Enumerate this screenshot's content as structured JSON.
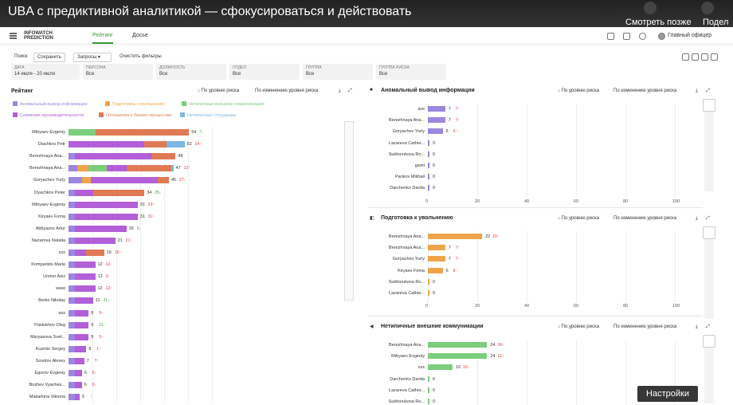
{
  "video": {
    "title": "UBA с предиктивной аналитикой — сфокусироваться и действовать",
    "watch_later": "Смотреть позже",
    "share": "Подел",
    "settings": "Настройки"
  },
  "app": {
    "logo_line1": "INFOWATCH",
    "logo_line2": "PREDICTION",
    "tabs": [
      "Рейтинг",
      "Досье"
    ],
    "user": "Главный офицер"
  },
  "toolbar": {
    "search": "Поиск",
    "save": "Сохранить",
    "queries": "Запросы",
    "clear": "Очистить фильтры"
  },
  "filters": [
    {
      "label": "ДАТА",
      "value": "14 июля - 20 июля"
    },
    {
      "label": "ПЕРСОНА",
      "value": "Все"
    },
    {
      "label": "ДОЛЖНОСТЬ",
      "value": "Все"
    },
    {
      "label": "ОТДЕЛ",
      "value": "Все"
    },
    {
      "label": "ГРУППА",
      "value": "Все"
    },
    {
      "label": "ГРУППА РИСКА",
      "value": "Все"
    }
  ],
  "rating": {
    "title": "Рейтинг",
    "sort1": "По уровню риска",
    "sort2": "По изменению уровня риска",
    "legend": [
      {
        "name": "Аномальный вывод информации",
        "color": "#9b87e0"
      },
      {
        "name": "Подготовка к увольнению",
        "color": "#f0a44a"
      },
      {
        "name": "Нетипичные внешние коммуникации",
        "color": "#7ccd7c"
      },
      {
        "name": "Снижение производительности",
        "color": "#b35fd8"
      },
      {
        "name": "Отношение к бизнес-процессам",
        "color": "#e07a55"
      },
      {
        "name": "Нетипичные сотрудники",
        "color": "#7fb6e3"
      }
    ],
    "rows": [
      {
        "name": "Mitryaev Evgeniy",
        "value": 54,
        "delta": "7",
        "dir": "down",
        "segs": [
          0,
          0,
          12,
          0,
          42,
          0
        ]
      },
      {
        "name": "Diachkov Petr",
        "value": 52,
        "delta": "14",
        "dir": "up",
        "segs": [
          0,
          0,
          0,
          34,
          10,
          8
        ]
      },
      {
        "name": "Berezhnaya Ana...",
        "value": 48,
        "delta": "",
        "dir": "",
        "segs": [
          3,
          0,
          0,
          34,
          11,
          0
        ]
      },
      {
        "name": "Berezhnaya Ana...",
        "value": 47,
        "delta": "12",
        "dir": "up",
        "segs": [
          4,
          5,
          8,
          9,
          20,
          1
        ]
      },
      {
        "name": "Goryachev Yuriy",
        "value": 45,
        "delta": "27",
        "dir": "up",
        "segs": [
          6,
          4,
          0,
          30,
          5,
          0
        ]
      },
      {
        "name": "Dyachkov Peter",
        "value": 34,
        "delta": "25",
        "dir": "down",
        "segs": [
          3,
          0,
          0,
          8,
          23,
          0
        ]
      },
      {
        "name": "Mitryaev Evgeniy",
        "value": 31,
        "delta": "23",
        "dir": "up",
        "segs": [
          3,
          0,
          0,
          28,
          0,
          0
        ]
      },
      {
        "name": "Kiryaev Foma",
        "value": 31,
        "delta": "31",
        "dir": "up",
        "segs": [
          3,
          0,
          0,
          28,
          0,
          0
        ]
      },
      {
        "name": "Abbyazov Artur",
        "value": 26,
        "delta": "5",
        "dir": "down",
        "segs": [
          3,
          0,
          0,
          23,
          0,
          0
        ]
      },
      {
        "name": "Nazarova Natalia",
        "value": 21,
        "delta": "21",
        "dir": "up",
        "segs": [
          3,
          0,
          0,
          18,
          0,
          0
        ]
      },
      {
        "name": "xxx",
        "value": 16,
        "delta": "16",
        "dir": "up",
        "segs": [
          3,
          0,
          0,
          5,
          8,
          0
        ]
      },
      {
        "name": "Komparists Maria",
        "value": 12,
        "delta": "12",
        "dir": "up",
        "segs": [
          3,
          0,
          0,
          9,
          0,
          0
        ]
      },
      {
        "name": "Unrinn Aziz",
        "value": 12,
        "delta": "3",
        "dir": "up",
        "segs": [
          3,
          0,
          0,
          9,
          0,
          0
        ]
      },
      {
        "name": "www",
        "value": 12,
        "delta": "12",
        "dir": "up",
        "segs": [
          3,
          0,
          0,
          9,
          0,
          0
        ]
      },
      {
        "name": "Berko Nikolay",
        "value": 11,
        "delta": "11",
        "dir": "down",
        "segs": [
          3,
          0,
          0,
          8,
          0,
          0
        ]
      },
      {
        "name": "avs",
        "value": 9,
        "delta": "9",
        "dir": "up",
        "segs": [
          3,
          0,
          0,
          6,
          0,
          0
        ]
      },
      {
        "name": "Pastukhov Oleg",
        "value": 9,
        "delta": "11",
        "dir": "down",
        "segs": [
          3,
          0,
          0,
          6,
          0,
          0
        ]
      },
      {
        "name": "Maryasova Svet...",
        "value": 9,
        "delta": "3",
        "dir": "up",
        "segs": [
          3,
          0,
          0,
          6,
          0,
          0
        ]
      },
      {
        "name": "Kuzmin Sergey",
        "value": 8,
        "delta": "1",
        "dir": "up",
        "segs": [
          3,
          0,
          0,
          5,
          0,
          0
        ]
      },
      {
        "name": "Sovidov Alexey",
        "value": 7,
        "delta": "7",
        "dir": "up",
        "segs": [
          3,
          0,
          0,
          4,
          0,
          0
        ]
      },
      {
        "name": "Egorov Evgeniy",
        "value": 6,
        "delta": "6",
        "dir": "up",
        "segs": [
          3,
          0,
          0,
          3,
          0,
          0
        ]
      },
      {
        "name": "Bozhev Vyaches...",
        "value": 6,
        "delta": "6",
        "dir": "up",
        "segs": [
          3,
          0,
          0,
          3,
          0,
          0
        ]
      },
      {
        "name": "Makarkina Viktoria",
        "value": 5,
        "delta": "",
        "dir": "up",
        "segs": [
          3,
          0,
          0,
          2,
          0,
          0
        ]
      }
    ]
  },
  "panels": [
    {
      "title": "Аномальный вывод информации",
      "icon": "■",
      "color": "#9b87e0",
      "sort1": "По уровню риска",
      "sort2": "По изменению уровня риска",
      "ticks": [
        "0",
        "20",
        "40",
        "60",
        "80",
        "100"
      ],
      "rows": [
        {
          "name": "avs",
          "value": 7,
          "delta": "7"
        },
        {
          "name": "Berezhnaya Ana...",
          "value": 7,
          "delta": "7"
        },
        {
          "name": "Goryachev Yuriy",
          "value": 6,
          "delta": "6"
        },
        {
          "name": "Lazareva Cather...",
          "value": 0,
          "delta": ""
        },
        {
          "name": "Sukhorukova Ro...",
          "value": 0,
          "delta": ""
        },
        {
          "name": "gemt",
          "value": 0,
          "delta": ""
        },
        {
          "name": "Pankov Mikhail",
          "value": 0,
          "delta": ""
        },
        {
          "name": "Darchenko Danila",
          "value": 0,
          "delta": ""
        }
      ]
    },
    {
      "title": "Подготовка к увольнению",
      "icon": "◧",
      "color": "#f0a44a",
      "sort1": "По уровню риска",
      "sort2": "По изменению уровня риска",
      "ticks": [
        "0",
        "20",
        "40",
        "60",
        "80",
        "100"
      ],
      "rows": [
        {
          "name": "Berezhnaya Ana...",
          "value": 22,
          "delta": "22"
        },
        {
          "name": "Berezhnaya Ana...",
          "value": 7,
          "delta": "7"
        },
        {
          "name": "Goryachev Yuriy",
          "value": 7,
          "delta": "7"
        },
        {
          "name": "Kiryaev Foma",
          "value": 6,
          "delta": "6"
        },
        {
          "name": "Sukhorukova Ro...",
          "value": 0,
          "delta": ""
        },
        {
          "name": "Lazareva Cather...",
          "value": 0,
          "delta": ""
        }
      ]
    },
    {
      "title": "Нетипичные внешние коммуникации",
      "icon": "◀",
      "color": "#7ccd7c",
      "sort1": "По уровню риска",
      "sort2": "По изменению уровня риска",
      "ticks": [],
      "rows": [
        {
          "name": "Berezhnaya Ana...",
          "value": 24,
          "delta": "24"
        },
        {
          "name": "Mitryaev Evgeniy",
          "value": 24,
          "delta": "12"
        },
        {
          "name": "xxx",
          "value": 10,
          "delta": "10"
        },
        {
          "name": "Darchenko Danila",
          "value": 0,
          "delta": ""
        },
        {
          "name": "Lazareva Cather...",
          "value": 0,
          "delta": ""
        },
        {
          "name": "Sukhorukova Ro...",
          "value": 0,
          "delta": ""
        }
      ]
    }
  ]
}
